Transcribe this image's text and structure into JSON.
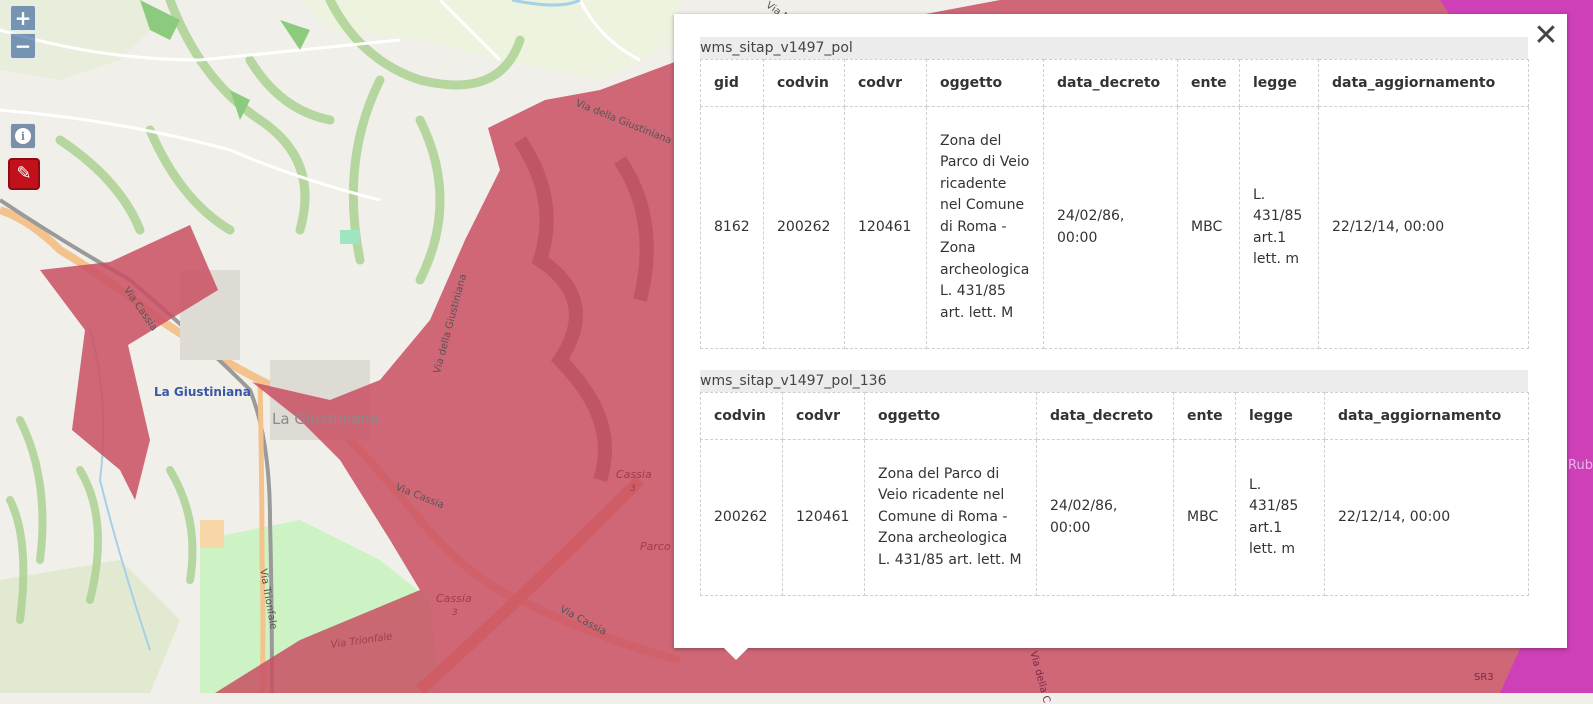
{
  "map": {
    "place_labels": {
      "la_giustiniana_blue": "La Giustiniana",
      "la_giustiniana_grey": "La Giustiniana",
      "rub": "Rub",
      "parco": "Parco"
    },
    "road_labels": {
      "via_della_giustiniana_1": "Via della Giustiniana",
      "via_della_giustiniana_2": "Via della Giustiniana",
      "via_cassia_1": "Via Cassia",
      "via_cassia_2": "Via Cassia",
      "via_cassia_3": "Via Cassia",
      "via_trionfale_1": "Via Trionfale",
      "via_trionfale_2": "Via Trionfale",
      "cassia_3": "Cassia",
      "cassia_3_num": "3",
      "cassia_2": "Cassia",
      "cassia_2_num": "3",
      "via_nu": "Via Nu",
      "sr3": "SR3",
      "via_della_c": "Via della C"
    },
    "colors": {
      "base": "#f1efe9",
      "vincolo": "#c94f63",
      "vincolo_alt": "#d2265a",
      "magenta": "#cc33cc"
    }
  },
  "controls": {
    "zoom_in": "+",
    "zoom_out": "−",
    "info_icon": "i",
    "draw_icon": "✎"
  },
  "popup": {
    "close_label": "✕",
    "layers": [
      {
        "title": "wms_sitap_v1497_pol",
        "columns": [
          "gid",
          "codvin",
          "codvr",
          "oggetto",
          "data_decreto",
          "ente",
          "legge",
          "data_aggiornamento"
        ],
        "rows": [
          [
            "8162",
            "200262",
            "120461",
            "Zona del Parco di Veio ricadente nel Comune di Roma - Zona archeologica L. 431/85 art. lett. M",
            "24/02/86, 00:00",
            "MBC",
            "L. 431/85 art.1 lett. m",
            "22/12/14, 00:00"
          ]
        ]
      },
      {
        "title": "wms_sitap_v1497_pol_136",
        "columns": [
          "codvin",
          "codvr",
          "oggetto",
          "data_decreto",
          "ente",
          "legge",
          "data_aggiornamento"
        ],
        "rows": [
          [
            "200262",
            "120461",
            "Zona del Parco di Veio ricadente nel Comune di Roma - Zona archeologica L. 431/85 art. lett. M",
            "24/02/86, 00:00",
            "MBC",
            "L. 431/85 art.1 lett. m",
            "22/12/14, 00:00"
          ]
        ]
      }
    ]
  }
}
